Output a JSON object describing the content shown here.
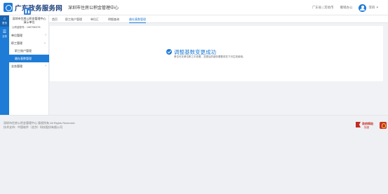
{
  "header": {
    "brand": "广东政务服务网",
    "portal": "深圳市住房公积金管理中心",
    "links": [
      "广东省 | 其他市",
      "撤销办公"
    ],
    "user": "李四"
  },
  "rail": {
    "items": [
      {
        "label": "首页",
        "icon": "home-icon"
      },
      {
        "label": "业务",
        "icon": "list-icon"
      }
    ]
  },
  "sidebar": {
    "org_name": "深圳市住房公积金管理中心演示单位",
    "org_id": "公积金账号：1067060276",
    "menu": [
      {
        "label": "单位管理",
        "expandable": true
      },
      {
        "label": "职工管理",
        "expandable": true
      },
      {
        "label": "职工账户管理",
        "expandable": false
      },
      {
        "label": "缴存基数管理",
        "expandable": false
      },
      {
        "label": "业务管理",
        "expandable": true
      }
    ]
  },
  "tabs": [
    "首页",
    "职工账户管理",
    "单位汇",
    "明细查询",
    "缴存基数管理"
  ],
  "result": {
    "title": "调整基数变更成功",
    "note": "单位可在单位职工中查看，变更后的缴存基数将在下月生效使用。"
  },
  "footer": {
    "copyright": "深圳市住房公积金管理中心 版权所有 All Rights Reserved.",
    "support": "技术支持：中国软件（北京）科技股份有限公司",
    "badge_1_line_1": "政府网站",
    "badge_1_line_2": "找错"
  },
  "colors": {
    "primary": "#1e7bd6",
    "rail_active": "#1665b3",
    "badge_red": "#c32a22"
  }
}
